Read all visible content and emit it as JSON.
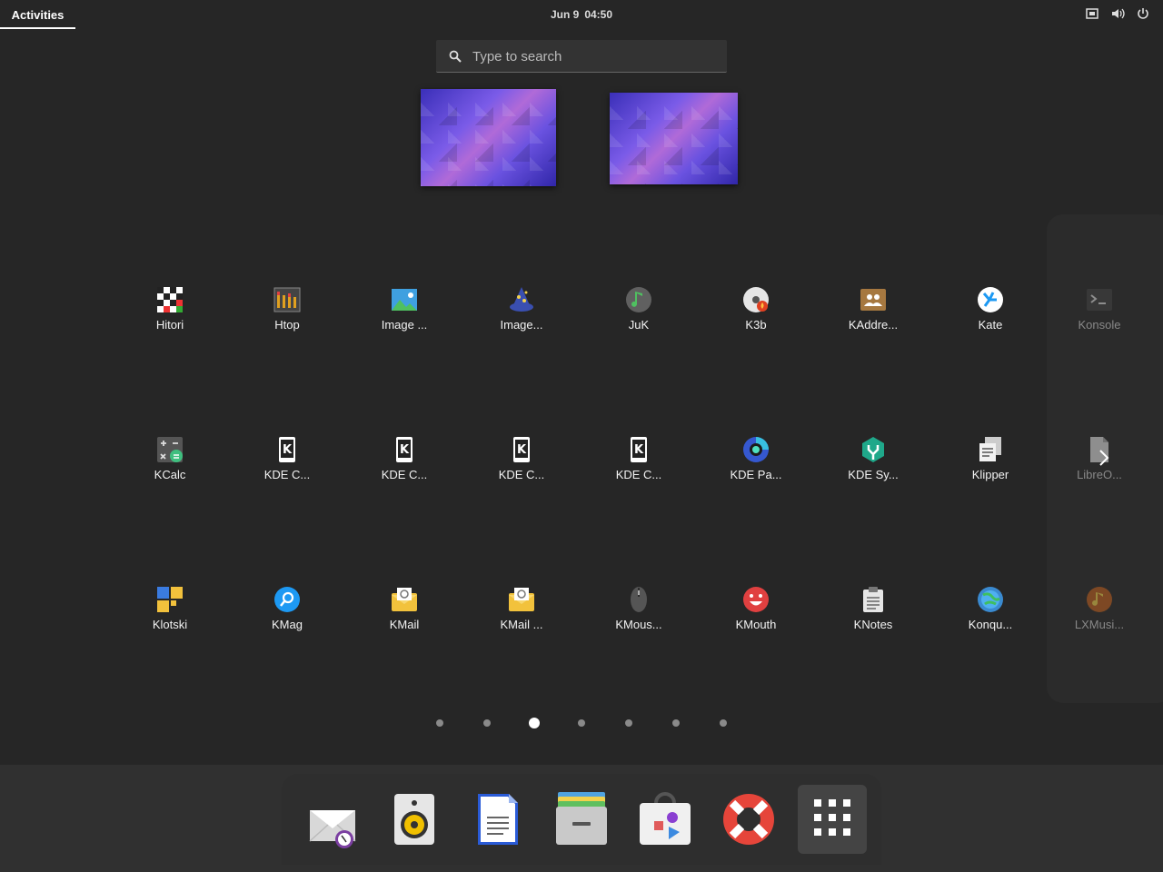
{
  "topbar": {
    "activities": "Activities",
    "date": "Jun 9",
    "time": "04:50"
  },
  "search": {
    "placeholder": "Type to search"
  },
  "apps": [
    {
      "label": "Hitori",
      "icon": "hitori-icon"
    },
    {
      "label": "Htop",
      "icon": "htop-icon"
    },
    {
      "label": "Image ...",
      "icon": "image-viewer-icon"
    },
    {
      "label": "Image...",
      "icon": "image-wizard-icon"
    },
    {
      "label": "JuK",
      "icon": "juk-icon"
    },
    {
      "label": "K3b",
      "icon": "k3b-icon"
    },
    {
      "label": "KAddre...",
      "icon": "kaddressbook-icon"
    },
    {
      "label": "Kate",
      "icon": "kate-icon"
    },
    {
      "label": "Konsole",
      "icon": "konsole-icon"
    },
    {
      "label": "KCalc",
      "icon": "kcalc-icon"
    },
    {
      "label": "KDE C...",
      "icon": "kde-connect-icon"
    },
    {
      "label": "KDE C...",
      "icon": "kde-connect-icon"
    },
    {
      "label": "KDE C...",
      "icon": "kde-connect-icon"
    },
    {
      "label": "KDE C...",
      "icon": "kde-connect-icon"
    },
    {
      "label": "KDE Pa...",
      "icon": "kde-partition-icon"
    },
    {
      "label": "KDE Sy...",
      "icon": "kde-system-icon"
    },
    {
      "label": "Klipper",
      "icon": "klipper-icon"
    },
    {
      "label": "LibreO...",
      "icon": "libreoffice-icon"
    },
    {
      "label": "Klotski",
      "icon": "klotski-icon"
    },
    {
      "label": "KMag",
      "icon": "kmag-icon"
    },
    {
      "label": "KMail",
      "icon": "kmail-icon"
    },
    {
      "label": "KMail ...",
      "icon": "kmail-icon"
    },
    {
      "label": "KMous...",
      "icon": "kmouse-icon"
    },
    {
      "label": "KMouth",
      "icon": "kmouth-icon"
    },
    {
      "label": "KNotes",
      "icon": "knotes-icon"
    },
    {
      "label": "Konqu...",
      "icon": "konqueror-icon"
    },
    {
      "label": "LXMusi...",
      "icon": "lxmusic-icon"
    }
  ],
  "pagination": {
    "pages": 7,
    "current": 3
  },
  "dock": [
    {
      "name": "evolution-icon"
    },
    {
      "name": "rhythmbox-icon"
    },
    {
      "name": "writer-icon"
    },
    {
      "name": "files-icon"
    },
    {
      "name": "software-icon"
    },
    {
      "name": "help-icon"
    },
    {
      "name": "show-apps-icon"
    }
  ],
  "colors": {
    "background": "#262626",
    "dock": "#303030",
    "accent": "#ffffff"
  }
}
